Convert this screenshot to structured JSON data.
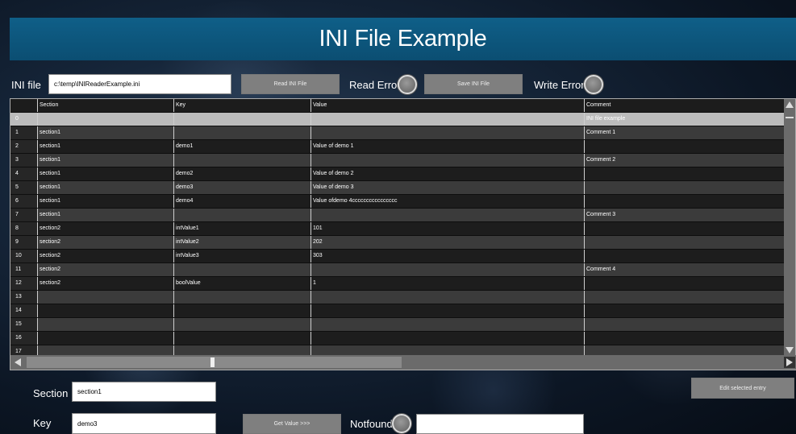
{
  "app": {
    "title": "INI File Example"
  },
  "file": {
    "label": "INI file",
    "path": "c:\\temp\\INIReaderExample.ini",
    "read_button": "Read INI File",
    "read_error_label": "Read Error",
    "save_button": "Save INI File",
    "write_error_label": "Write Error"
  },
  "table": {
    "columns": [
      "",
      "Section",
      "Key",
      "Value",
      "Comment"
    ],
    "rows": [
      {
        "num": "0",
        "section": "",
        "key": "",
        "value": "",
        "comment": "INI file example"
      },
      {
        "num": "1",
        "section": "section1",
        "key": "",
        "value": "",
        "comment": "Comment 1"
      },
      {
        "num": "2",
        "section": "section1",
        "key": "demo1",
        "value": "Value of demo 1",
        "comment": ""
      },
      {
        "num": "3",
        "section": "section1",
        "key": "",
        "value": "",
        "comment": "Comment 2"
      },
      {
        "num": "4",
        "section": "section1",
        "key": "demo2",
        "value": "Value of demo 2",
        "comment": ""
      },
      {
        "num": "5",
        "section": "section1",
        "key": "demo3",
        "value": "Value of demo 3",
        "comment": ""
      },
      {
        "num": "6",
        "section": "section1",
        "key": "demo4",
        "value": "Value ofdemo 4cccccccccccccccc",
        "comment": ""
      },
      {
        "num": "7",
        "section": "section1",
        "key": "",
        "value": "",
        "comment": "Comment 3"
      },
      {
        "num": "8",
        "section": "section2",
        "key": "intValue1",
        "value": "101",
        "comment": ""
      },
      {
        "num": "9",
        "section": "section2",
        "key": "intValue2",
        "value": "202",
        "comment": ""
      },
      {
        "num": "10",
        "section": "section2",
        "key": "intValue3",
        "value": "303",
        "comment": ""
      },
      {
        "num": "11",
        "section": "section2",
        "key": "",
        "value": "",
        "comment": "Comment 4"
      },
      {
        "num": "12",
        "section": "section2",
        "key": "boolValue",
        "value": "1",
        "comment": ""
      },
      {
        "num": "13",
        "section": "",
        "key": "",
        "value": "",
        "comment": ""
      },
      {
        "num": "14",
        "section": "",
        "key": "",
        "value": "",
        "comment": ""
      },
      {
        "num": "15",
        "section": "",
        "key": "",
        "value": "",
        "comment": ""
      },
      {
        "num": "16",
        "section": "",
        "key": "",
        "value": "",
        "comment": ""
      },
      {
        "num": "17",
        "section": "",
        "key": "",
        "value": "",
        "comment": ""
      }
    ],
    "selected_row": 0
  },
  "editor": {
    "section_label": "Section",
    "section_value": "section1",
    "key_label": "Key",
    "key_value": "demo3",
    "get_value_button": "Get Value >>>",
    "notfound_label": "Notfound",
    "result_value": "",
    "edit_button": "Edit selected entry"
  },
  "colors": {
    "title_bar": "#0b5a82",
    "button": "#7f7f7f",
    "selected_row": "#bcbcbc"
  }
}
